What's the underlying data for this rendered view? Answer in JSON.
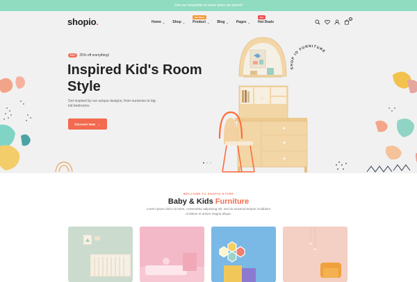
{
  "topbar": {
    "text": "Join our newsletter to know when we launch!"
  },
  "header": {
    "logo_text": "shopio",
    "logo_dot": ".",
    "nav": [
      {
        "label": "Home",
        "has_menu": true,
        "badge": ""
      },
      {
        "label": "Shop",
        "has_menu": true,
        "badge": ""
      },
      {
        "label": "Product",
        "has_menu": true,
        "badge": "Hot Items"
      },
      {
        "label": "Blog",
        "has_menu": true,
        "badge": ""
      },
      {
        "label": "Pages",
        "has_menu": true,
        "badge": ""
      },
      {
        "label": "Hot Deals",
        "has_menu": false,
        "badge": "Hot"
      }
    ],
    "icons": [
      "search-icon",
      "heart-icon",
      "user-icon",
      "cart-icon"
    ],
    "cart_count": "0"
  },
  "hero": {
    "badge": "HOT",
    "badge_text": "25% off everything!",
    "title": "Inspired Kid's Room Style",
    "subtitle": "Get inspired by our unique designs, from nurseries to big kid bedrooms.",
    "button_label": "Discover Now",
    "curved_text": "SHOP IO FURNITURE KIDS",
    "slides": 3,
    "active_slide": 1
  },
  "featured": {
    "eyebrow": "WELCOME TO SHOPIO STORE",
    "title_a": "Baby & Kids ",
    "title_b": "Furniture",
    "description": "Lorem ipsum dolor sit amet, consectetur adipiscing elit, sed do eiusmod tempor incididunt ut labore et dolore magna aliqua."
  },
  "colors": {
    "accent": "#f26a4f",
    "topbar": "#8fdcc0",
    "hero_bg": "#f1f1f1"
  }
}
